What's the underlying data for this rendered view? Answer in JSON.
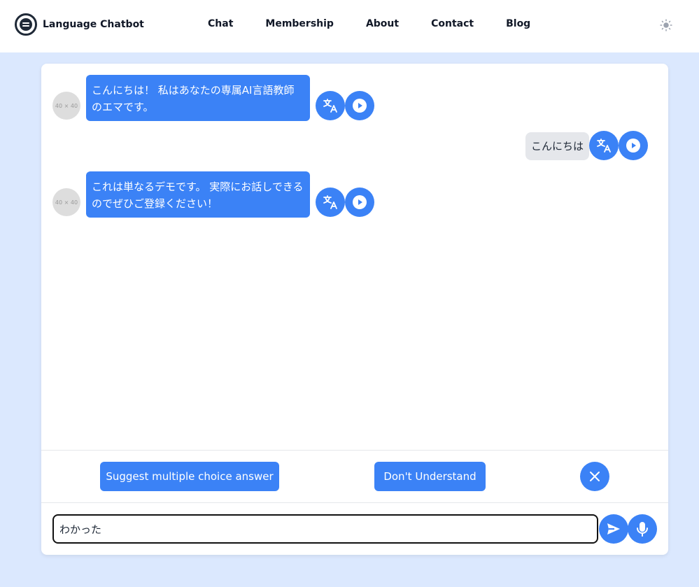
{
  "nav": {
    "brand": "Language Chatbot",
    "links": [
      "Chat",
      "Membership",
      "About",
      "Contact",
      "Blog"
    ]
  },
  "chat": {
    "messages": [
      {
        "role": "bot",
        "avatar_label": "40 × 40",
        "text": "こんにちは！ 私はあなたの専属AI言語教師のエマです。"
      },
      {
        "role": "user",
        "text": "こんにちは"
      },
      {
        "role": "bot",
        "avatar_label": "40 × 40",
        "text": "これは単なるデモです。 実際にお話しできるのでぜひご登録ください！"
      }
    ]
  },
  "actions": {
    "suggest_label": "Suggest multiple choice answer",
    "dont_understand_label": "Don't Understand"
  },
  "composer": {
    "value": "わかった"
  },
  "colors": {
    "accent": "#3b82f6",
    "page_bg": "#dbe8fe",
    "user_bubble": "#e5e7eb"
  }
}
